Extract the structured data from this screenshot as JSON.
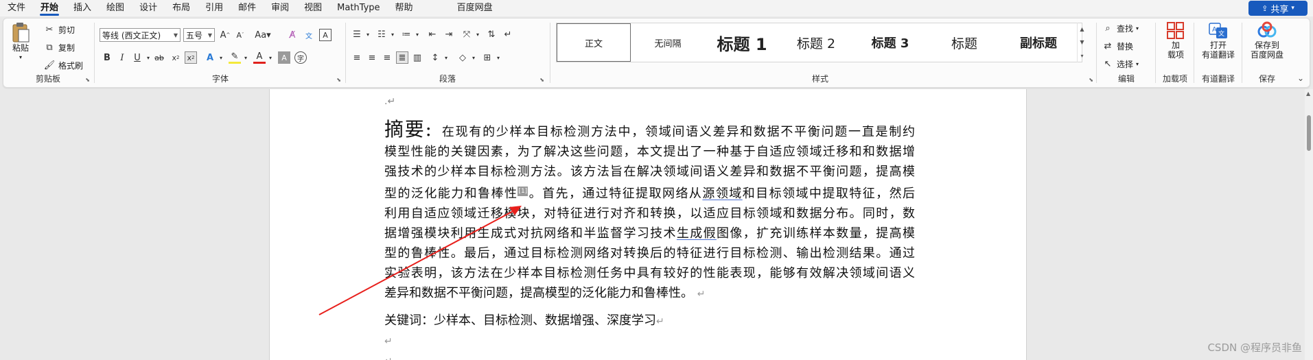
{
  "menu": {
    "items": [
      "文件",
      "开始",
      "插入",
      "绘图",
      "设计",
      "布局",
      "引用",
      "邮件",
      "审阅",
      "视图",
      "MathType",
      "帮助",
      "百度网盘"
    ],
    "active_index": 1,
    "share_label": "共享"
  },
  "ribbon": {
    "clipboard": {
      "paste": "粘贴",
      "cut": "剪切",
      "copy": "复制",
      "format_painter": "格式刷",
      "group_label": "剪贴板"
    },
    "font": {
      "font_name": "等线 (西文正文)",
      "font_size": "五号",
      "group_label": "字体"
    },
    "paragraph": {
      "group_label": "段落"
    },
    "styles": {
      "items": [
        "正文",
        "无间隔",
        "标题 1",
        "标题 2",
        "标题 3",
        "标题",
        "副标题"
      ],
      "group_label": "样式"
    },
    "editing": {
      "find": "查找",
      "replace": "替换",
      "select": "选择",
      "group_label": "编辑"
    },
    "addins": {
      "button": "加\n载项",
      "group_label": "加载项"
    },
    "youdao": {
      "button": "打开\n有道翻译",
      "group_label": "有道翻译"
    },
    "save": {
      "button": "保存到\n百度网盘",
      "group_label": "保存"
    }
  },
  "document": {
    "first_mark": ".↵",
    "abstract_title": "摘要:",
    "abstract_lines": [
      "在现有的少样本目标检测方法中，领域间语义差异和数据不平衡问题一直是制约",
      "模型性能的关键因素，为了解决这些问题，本文提出了一种基于自适应领域迁移和和数据增",
      "强技术的少样本目标检测方法。该方法旨在解决领域间语义差异和数据不平衡问题，提高模",
      "型的泛化能力和鲁棒性",
      "。首先，通过特征提取网络从",
      "源领域",
      "和目标领域中提取特征，然后",
      "利用自适应领域迁移模块，对特征进行对齐和转换，以适应目标领域和数据分布。同时，数",
      "据增强模块利用生成式对抗网络和半监督学习技术",
      "生成假",
      "图像，扩充训练样本数量，提高模",
      "型的鲁棒性。最后，通过目标检测网络对转换后的特征进行目标检测、输出检测结果。通过",
      "实验表明，该方法在少样本目标检测任务中具有较好的性能表现，能够有效解决领域间语义",
      "差异和数据不平衡问题，提高模型的泛化能力和鲁棒性。"
    ],
    "citation": "[1]",
    "return_mark": "↵",
    "keywords": "关键词：少样本、目标检测、数据增强、深度学习"
  },
  "annotation": {
    "color": "#e8201c"
  },
  "watermark": "CSDN @程序员非鱼"
}
